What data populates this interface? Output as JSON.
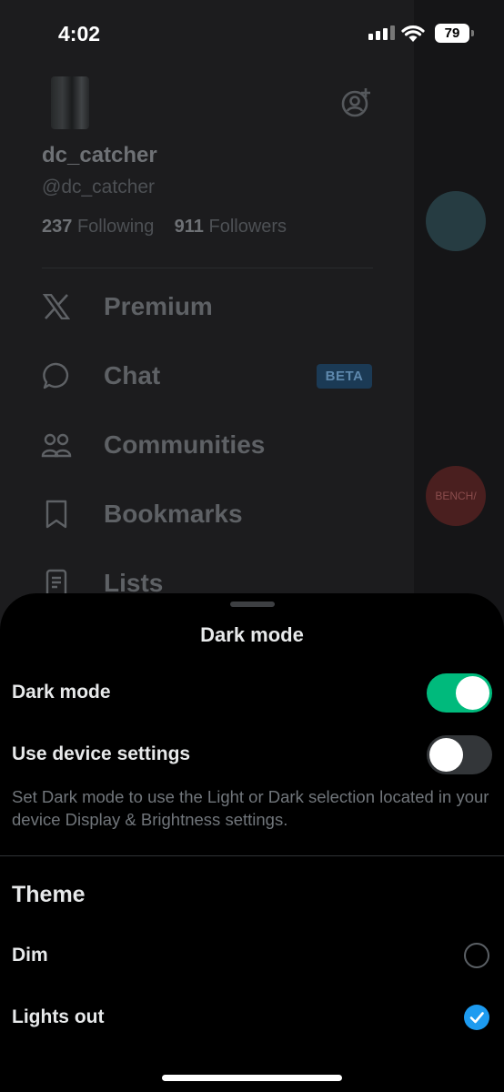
{
  "status_bar": {
    "time": "4:02",
    "battery": "79"
  },
  "profile": {
    "display_name": "dc_catcher",
    "handle": "@dc_catcher",
    "following_count": "237",
    "following_label": "Following",
    "followers_count": "911",
    "followers_label": "Followers"
  },
  "nav": {
    "items": [
      {
        "label": "Premium",
        "icon": "x-logo-icon"
      },
      {
        "label": "Chat",
        "icon": "chat-bubble-icon",
        "badge": "BETA"
      },
      {
        "label": "Communities",
        "icon": "people-icon"
      },
      {
        "label": "Bookmarks",
        "icon": "bookmark-icon"
      },
      {
        "label": "Lists",
        "icon": "list-icon"
      }
    ]
  },
  "feed": {
    "partial_avatar_text": "BENCH/"
  },
  "sheet": {
    "title": "Dark mode",
    "dark_mode_label": "Dark mode",
    "dark_mode_on": true,
    "device_settings_label": "Use device settings",
    "device_settings_on": false,
    "helper_text": "Set Dark mode to use the Light or Dark selection located in your device Display & Brightness settings.",
    "theme_title": "Theme",
    "themes": [
      {
        "label": "Dim",
        "selected": false
      },
      {
        "label": "Lights out",
        "selected": true
      }
    ]
  },
  "colors": {
    "accent": "#1d9bf0",
    "toggle_on": "#00ba7c",
    "background": "#000000"
  }
}
